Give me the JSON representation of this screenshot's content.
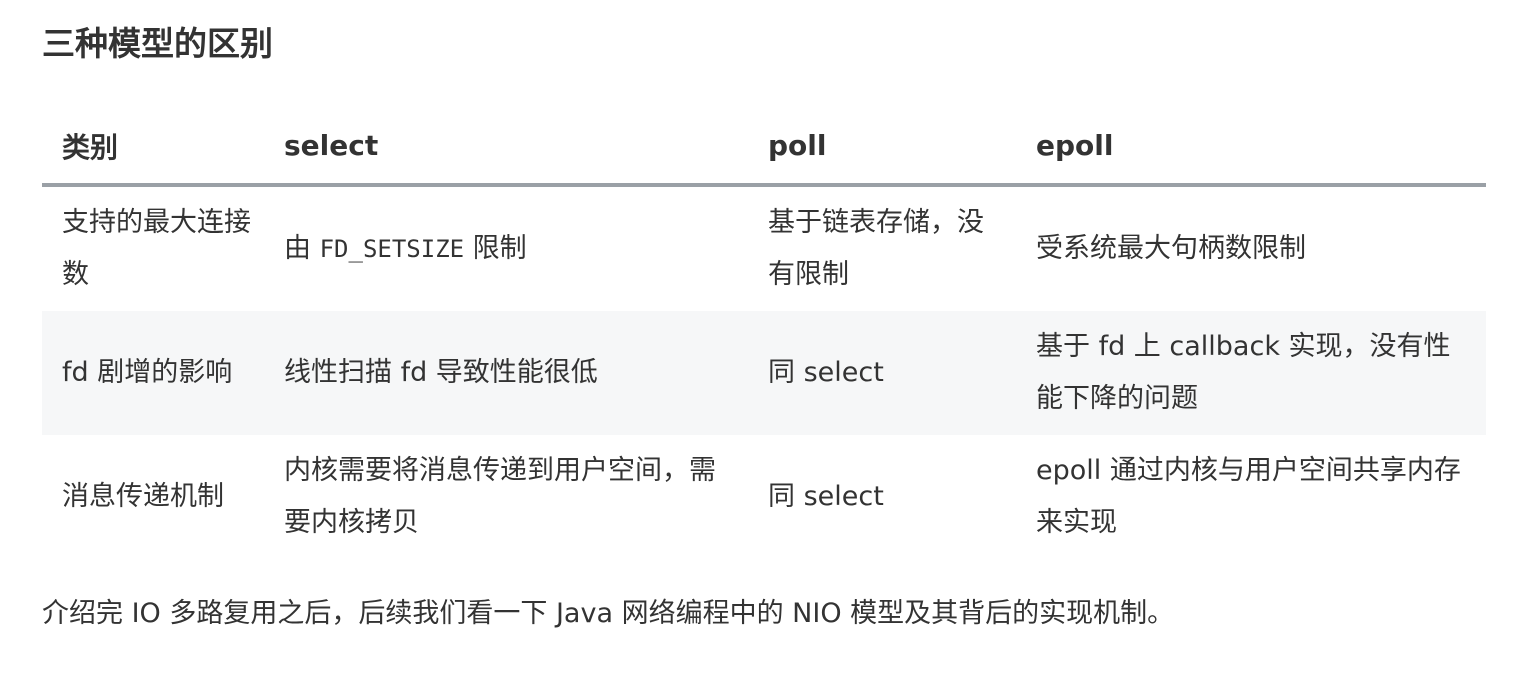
{
  "heading": "三种模型的区别",
  "table": {
    "headers": [
      "类别",
      "select",
      "poll",
      "epoll"
    ],
    "rows": [
      {
        "category": "支持的最大连接数",
        "select": {
          "prefix": "由 ",
          "code": "FD_SETSIZE",
          "suffix": " 限制"
        },
        "poll": "基于链表存储，没有限制",
        "epoll": "受系统最大句柄数限制"
      },
      {
        "category": "fd 剧增的影响",
        "select": "线性扫描 fd 导致性能很低",
        "poll": "同 select",
        "epoll": "基于 fd 上 callback 实现，没有性能下降的问题"
      },
      {
        "category": "消息传递机制",
        "select": "内核需要将消息传递到用户空间，需要内核拷贝",
        "poll": "同 select",
        "epoll": "epoll 通过内核与用户空间共享内存来实现"
      }
    ]
  },
  "footer": "介绍完 IO 多路复用之后，后续我们看一下 Java 网络编程中的 NIO 模型及其背后的实现机制。"
}
